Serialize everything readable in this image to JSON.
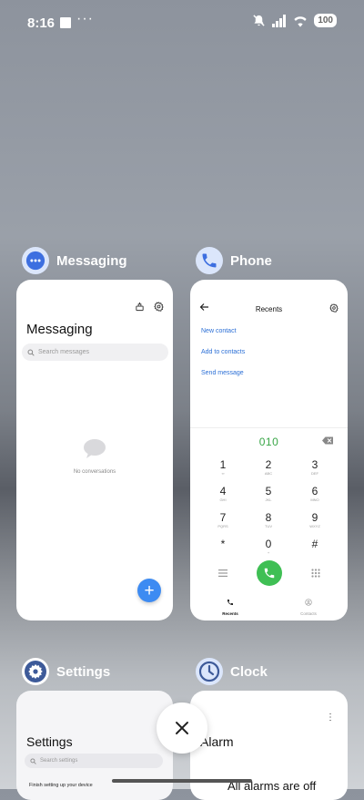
{
  "status_bar": {
    "time": "8:16",
    "dots": "···",
    "battery": "100",
    "icons": [
      "notification-square-icon",
      "mute-icon",
      "signal-icon",
      "wifi-icon",
      "battery-icon"
    ]
  },
  "cards": {
    "messaging": {
      "label": "Messaging",
      "icon": "chat-bubble-icon",
      "icon_color": "#3d6fe0",
      "title": "Messaging",
      "search_placeholder": "Search messages",
      "empty_text": "No conversations",
      "fab_label": "+"
    },
    "phone": {
      "label": "Phone",
      "icon": "phone-icon",
      "icon_color": "#3d6fe0",
      "title": "Recents",
      "links": [
        "New contact",
        "Add to contacts",
        "Send message"
      ],
      "dialed_number": "010",
      "keys": [
        {
          "digit": "1",
          "letters": "∞"
        },
        {
          "digit": "2",
          "letters": "ABC"
        },
        {
          "digit": "3",
          "letters": "DEF"
        },
        {
          "digit": "4",
          "letters": "GHI"
        },
        {
          "digit": "5",
          "letters": "JKL"
        },
        {
          "digit": "6",
          "letters": "MNO"
        },
        {
          "digit": "7",
          "letters": "PQRS"
        },
        {
          "digit": "8",
          "letters": "TUV"
        },
        {
          "digit": "9",
          "letters": "WXYZ"
        },
        {
          "digit": "*",
          "letters": ""
        },
        {
          "digit": "0",
          "letters": "+"
        },
        {
          "digit": "#",
          "letters": ""
        }
      ],
      "tabs": [
        "Recents",
        "Contacts"
      ],
      "call_color": "#3fbf54"
    },
    "settings": {
      "label": "Settings",
      "icon": "gear-icon",
      "title": "Settings",
      "search_placeholder": "Search settings",
      "first_item": "Finish setting up your device"
    },
    "clock": {
      "label": "Clock",
      "icon": "clock-icon",
      "title": "Alarm",
      "status": "All alarms are off"
    }
  },
  "controls": {
    "close_icon": "close-icon"
  }
}
